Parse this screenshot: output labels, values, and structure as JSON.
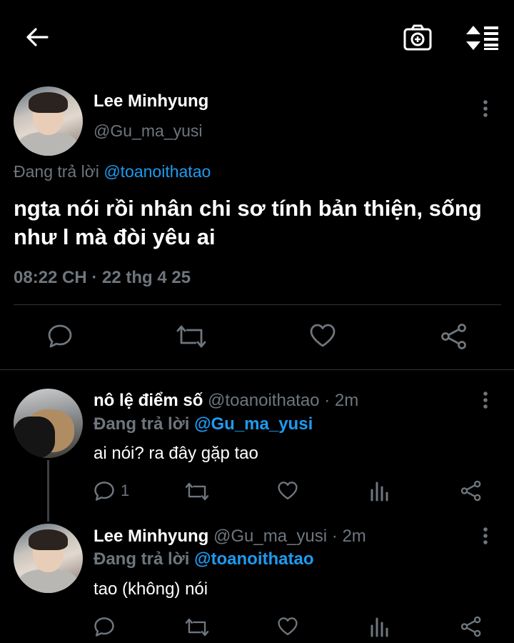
{
  "colors": {
    "accent": "#1d9bf0",
    "muted": "#6e767d",
    "text": "#e7e9ea"
  },
  "header": {
    "back_icon": "arrow-left-icon",
    "camera_icon": "camera-plus-icon",
    "sort_icon": "sort-icon"
  },
  "main_tweet": {
    "name": "Lee Minhyung",
    "handle": "@Gu_ma_yusi",
    "reply_prefix": "Đang trả lời",
    "reply_to": "@toanoithatao",
    "text": "ngta nói rồi nhân chi sơ tính bản thiện, sống như l mà đòi yêu ai",
    "timestamp": "08:22 CH · 22 thg 4 25"
  },
  "replies": [
    {
      "name": "nô lệ điểm số",
      "handle": "@toanoithatao",
      "time": "· 2m",
      "reply_prefix": "Đang trả lời",
      "reply_to": "@Gu_ma_yusi",
      "text": "ai nói? ra đây gặp tao",
      "reply_count": "1"
    },
    {
      "name": "Lee Minhyung",
      "handle": "@Gu_ma_yusi",
      "time": "· 2m",
      "reply_prefix": "Đang trả lời",
      "reply_to": "@toanoithatao",
      "text": "tao (không) nói",
      "reply_count": ""
    }
  ]
}
